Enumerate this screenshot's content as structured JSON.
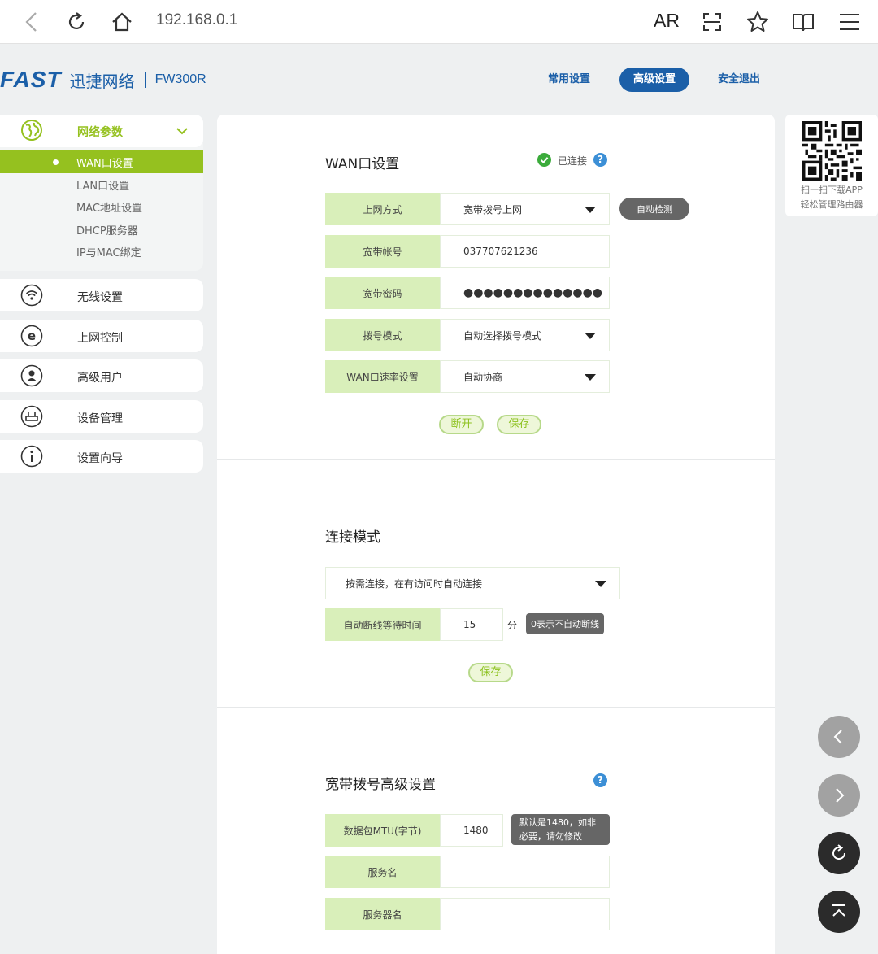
{
  "browser": {
    "url": "192.168.0.1",
    "ar_label": "AR"
  },
  "header": {
    "logo_brand": "FAST",
    "logo_cn": "迅捷网络",
    "model": "FW300R",
    "nav": [
      "常用设置",
      "高级设置",
      "安全退出"
    ],
    "active_nav": "高级设置"
  },
  "sidebar": {
    "group": {
      "label": "网络参数",
      "items": [
        "WAN口设置",
        "LAN口设置",
        "MAC地址设置",
        "DHCP服务器",
        "IP与MAC绑定"
      ],
      "active": "WAN口设置"
    },
    "items": [
      "无线设置",
      "上网控制",
      "高级用户",
      "设备管理",
      "设置向导"
    ]
  },
  "wan": {
    "title": "WAN口设置",
    "status": "已连接",
    "rows": [
      {
        "label": "上网方式",
        "value": "宽带拨号上网"
      },
      {
        "label": "宽带帐号",
        "value": "037707621236"
      },
      {
        "label": "宽带密码",
        "value": "●●●●●●●●●●●●●●"
      },
      {
        "label": "拨号模式",
        "value": "自动选择拨号模式"
      },
      {
        "label": "WAN口速率设置",
        "value": "自动协商"
      }
    ],
    "auto_detect": "自动检测",
    "disconnect": "断开",
    "save": "保存"
  },
  "connection": {
    "title": "连接模式",
    "mode": "按需连接，在有访问时自动连接",
    "wait_label": "自动断线等待时间",
    "wait_value": "15",
    "wait_unit": "分",
    "wait_hint": "0表示不自动断线",
    "save": "保存"
  },
  "advanced": {
    "title": "宽带拨号高级设置",
    "mtu_label": "数据包MTU(字节)",
    "mtu_value": "1480",
    "mtu_hint_1": "默认是1480，如非",
    "mtu_hint_2": "必要，请勿修改",
    "service_label": "服务名",
    "server_label": "服务器名"
  },
  "qr": {
    "line1": "扫一扫下载APP",
    "line2": "轻松管理路由器"
  },
  "colors": {
    "brand_blue": "#1b5fa8",
    "accent_green": "#95c11f",
    "label_bg": "#d9efba"
  }
}
